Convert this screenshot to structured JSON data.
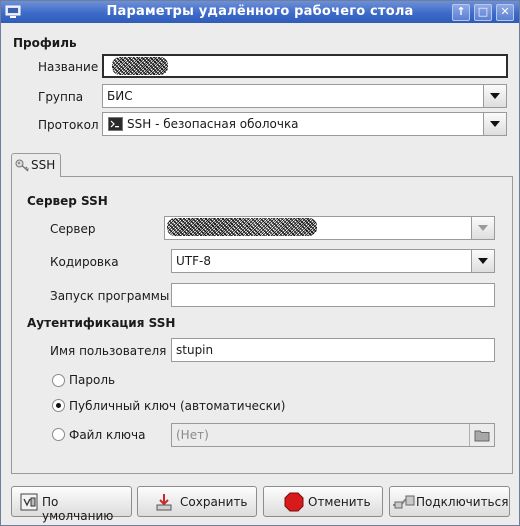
{
  "window": {
    "title": "Параметры удалённого рабочего стола"
  },
  "profile": {
    "section_title": "Профиль",
    "name_label": "Название",
    "name_value": "",
    "group_label": "Группа",
    "group_value": "БИС",
    "protocol_label": "Протокол",
    "protocol_value": "SSH - безопасная оболочка"
  },
  "tabs": [
    {
      "label": "SSH"
    }
  ],
  "ssh": {
    "server_section_title": "Сервер SSH",
    "server_label": "Сервер",
    "server_value": "",
    "encoding_label": "Кодировка",
    "encoding_value": "UTF-8",
    "startup_label": "Запуск программы",
    "startup_value": "",
    "auth_section_title": "Аутентификация SSH",
    "username_label": "Имя пользователя",
    "username_value": "stupin",
    "auth_options": [
      {
        "label": "Пароль",
        "checked": false
      },
      {
        "label": "Публичный ключ (автоматически)",
        "checked": true
      },
      {
        "label": "Файл ключа",
        "checked": false
      }
    ],
    "keyfile_value": "(Нет)"
  },
  "buttons": {
    "default_label": "По умолчанию",
    "save_label": "Сохранить",
    "cancel_label": "Отменить",
    "connect_label": "Подключиться"
  }
}
